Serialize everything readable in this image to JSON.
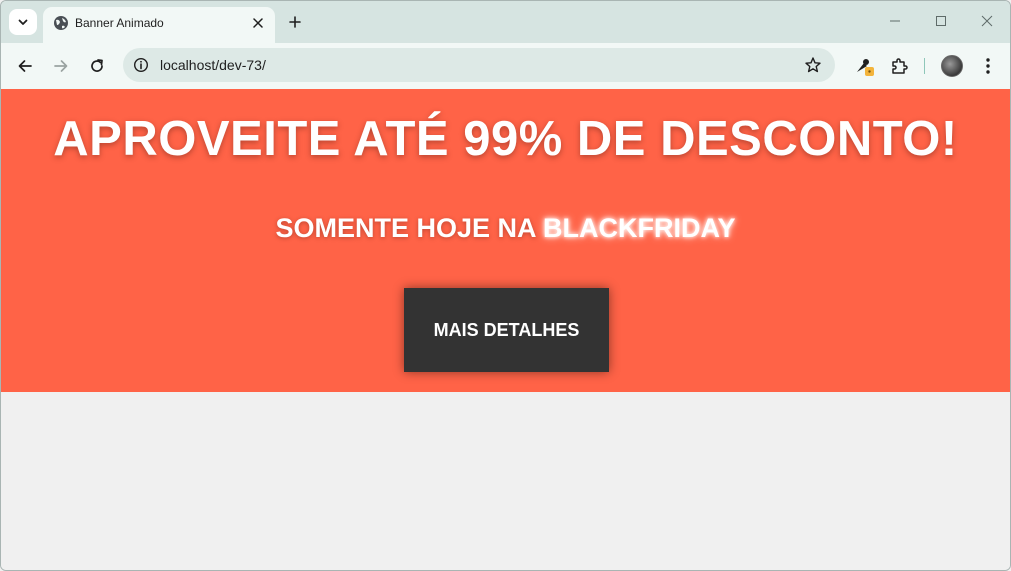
{
  "browser": {
    "tab": {
      "title": "Banner Animado",
      "favicon": "globe-icon"
    },
    "address_bar": {
      "url": "localhost/dev-73/"
    },
    "colors": {
      "tabstrip": "#d6e4e1",
      "toolbar": "#f2f8f6",
      "omnibox": "#dde9e6"
    }
  },
  "banner": {
    "headline": "APROVEITE ATÉ 99% DE DESCONTO!",
    "subline_prefix": "SOMENTE HOJE NA ",
    "subline_highlight": "BLACKFRIDAY",
    "cta_label": "MAIS DETALHES",
    "colors": {
      "background": "#ff6347",
      "button": "#333333",
      "text": "#ffffff",
      "page": "#f0f0f0"
    }
  }
}
